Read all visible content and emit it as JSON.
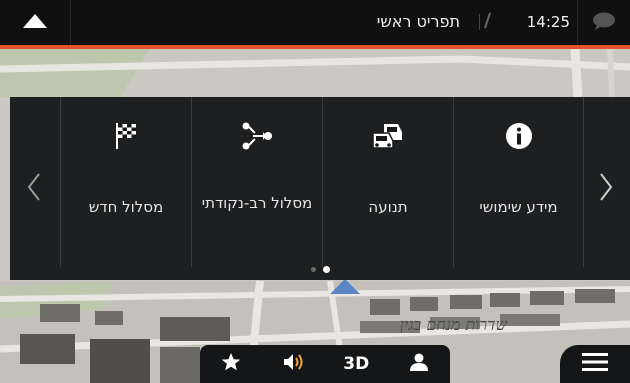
{
  "topbar": {
    "title": "תפריט ראשי",
    "time": "14:25",
    "home_icon": "up-arrow-icon",
    "message_icon": "chat-bubble-icon"
  },
  "menu": {
    "tiles": [
      {
        "label": "מסלול חדש",
        "icon": "checkered-flag-icon"
      },
      {
        "label": "מסלול רב-נקודתי",
        "icon": "multi-waypoint-icon"
      },
      {
        "label": "תנועה",
        "icon": "traffic-cars-icon"
      },
      {
        "label": "מידע שימושי",
        "icon": "info-icon"
      }
    ],
    "page_count": 2,
    "active_page": 2
  },
  "bottombar": {
    "view_mode_label": "3D"
  },
  "map": {
    "road_label": "שדרות מנחם בגין"
  },
  "colors": {
    "accent": "#e0532c",
    "panel_bg": "#16181a",
    "topbar_bg": "#101010"
  }
}
